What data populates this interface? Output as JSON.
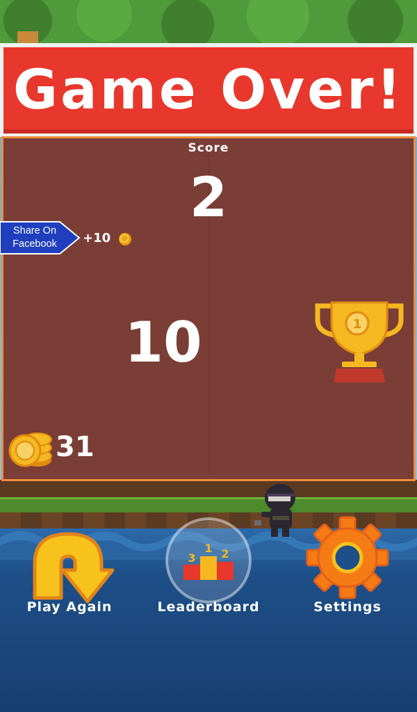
{
  "banner": {
    "title": "Game Over!"
  },
  "score": {
    "label": "Score",
    "value": "2"
  },
  "best": {
    "value": "10"
  },
  "share": {
    "label_line1": "Share On",
    "label_line2": "Facebook",
    "reward": "+10"
  },
  "coins": {
    "value": "31"
  },
  "buttons": {
    "play_again": "Play Again",
    "leaderboard": "Leaderboard",
    "settings": "Settings"
  },
  "trophy": {
    "rank": "1"
  },
  "leaderboard_icon": {
    "ranks": [
      "3",
      "1",
      "2"
    ]
  },
  "colors": {
    "banner_red": "#e8372c",
    "panel_brown": "#7a3e36",
    "panel_border": "#f08c3c",
    "share_blue": "#1f3fbf",
    "gold": "#f5b820"
  },
  "icons": [
    "facebook-share-icon",
    "coin-icon",
    "trophy-icon",
    "coin-stack-icon",
    "replay-arrow-icon",
    "podium-icon",
    "gear-icon"
  ]
}
